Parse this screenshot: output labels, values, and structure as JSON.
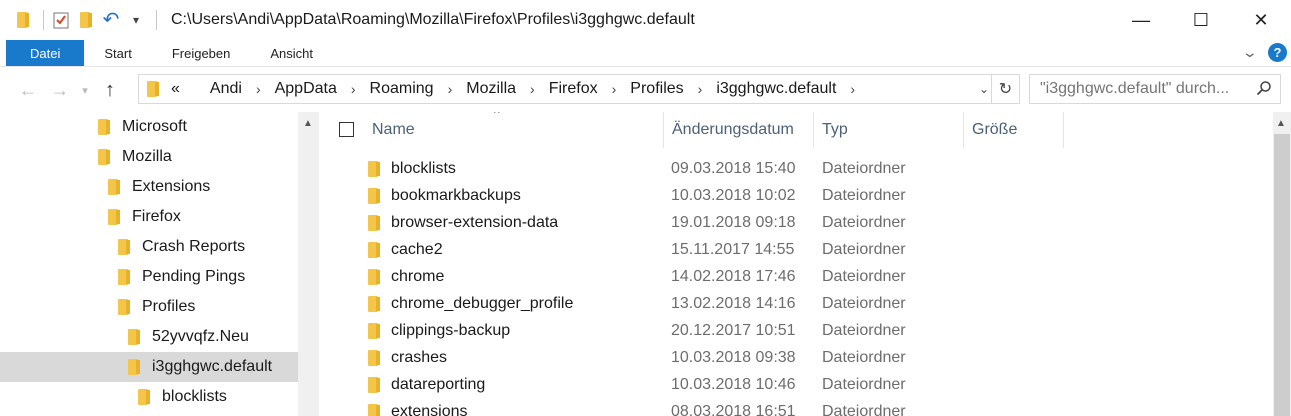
{
  "titlebar": {
    "path": "C:\\Users\\Andi\\AppData\\Roaming\\Mozilla\\Firefox\\Profiles\\i3gghgwc.default",
    "minimize": "—",
    "maximize": "☐",
    "close": "✕"
  },
  "ribbon": {
    "tabs": [
      {
        "label": "Datei",
        "active": true
      },
      {
        "label": "Start"
      },
      {
        "label": "Freigeben"
      },
      {
        "label": "Ansicht"
      }
    ],
    "help": "?"
  },
  "address": {
    "overflow": "«",
    "crumbs": [
      "Andi",
      "AppData",
      "Roaming",
      "Mozilla",
      "Firefox",
      "Profiles",
      "i3gghgwc.default"
    ]
  },
  "search": {
    "placeholder": "\"i3gghgwc.default\" durch..."
  },
  "tree": [
    {
      "label": "Microsoft",
      "indent": 0
    },
    {
      "label": "Mozilla",
      "indent": 0
    },
    {
      "label": "Extensions",
      "indent": 1
    },
    {
      "label": "Firefox",
      "indent": 1
    },
    {
      "label": "Crash Reports",
      "indent": 2
    },
    {
      "label": "Pending Pings",
      "indent": 2
    },
    {
      "label": "Profiles",
      "indent": 2
    },
    {
      "label": "52yvvqfz.Neu",
      "indent": 3
    },
    {
      "label": "i3gghgwc.default",
      "indent": 3,
      "selected": true
    },
    {
      "label": "blocklists",
      "indent": 4
    }
  ],
  "columns": {
    "name": "Name",
    "date": "Änderungsdatum",
    "type": "Typ",
    "size": "Größe"
  },
  "files": [
    {
      "name": "blocklists",
      "date": "09.03.2018 15:40",
      "type": "Dateiordner"
    },
    {
      "name": "bookmarkbackups",
      "date": "10.03.2018 10:02",
      "type": "Dateiordner"
    },
    {
      "name": "browser-extension-data",
      "date": "19.01.2018 09:18",
      "type": "Dateiordner"
    },
    {
      "name": "cache2",
      "date": "15.11.2017 14:55",
      "type": "Dateiordner"
    },
    {
      "name": "chrome",
      "date": "14.02.2018 17:46",
      "type": "Dateiordner"
    },
    {
      "name": "chrome_debugger_profile",
      "date": "13.02.2018 14:16",
      "type": "Dateiordner"
    },
    {
      "name": "clippings-backup",
      "date": "20.12.2017 10:51",
      "type": "Dateiordner"
    },
    {
      "name": "crashes",
      "date": "10.03.2018 09:38",
      "type": "Dateiordner"
    },
    {
      "name": "datareporting",
      "date": "10.03.2018 10:46",
      "type": "Dateiordner"
    },
    {
      "name": "extensions",
      "date": "08.03.2018 16:51",
      "type": "Dateiordner"
    }
  ],
  "colors": {
    "accent": "#1979ca",
    "folder": "#f3c64a",
    "selection": "#d9d9d9"
  }
}
